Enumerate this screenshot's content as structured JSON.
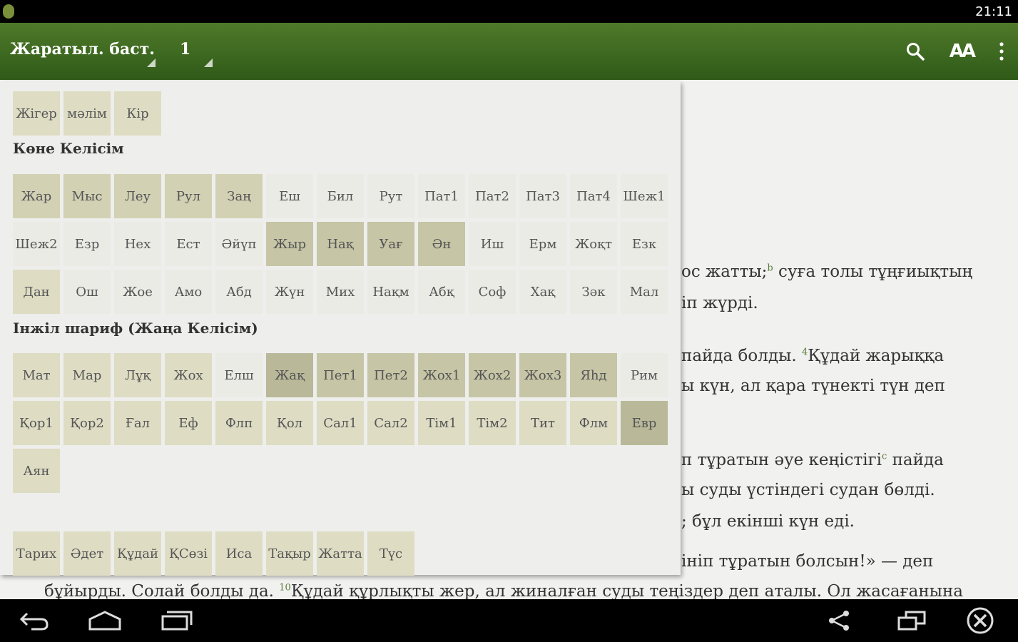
{
  "status_bar": {
    "time": "21:11"
  },
  "action_bar": {
    "book_title": "Жаратыл. баст.",
    "chapter": "1",
    "icons": [
      "search-icon",
      "text-size-icon",
      "overflow-menu-icon"
    ],
    "text_size_label": "AA"
  },
  "reader": {
    "lines": [
      {
        "text": "ос жатты;",
        "sup": "b",
        "rest": " суға толы тұңғиықтың"
      },
      {
        "text": "іп жүрді."
      },
      {
        "text": "пайда болды. ",
        "sup": "4",
        "rest": "Құдай жарыққа"
      },
      {
        "text": "ы күн, ал қара түнекті түн деп"
      },
      {
        "text": "п тұратын әуе кеңістігі",
        "sup": "c",
        "rest": " пайда"
      },
      {
        "text": "ы суды үстіндегі судан бөлді."
      },
      {
        "text": "; бұл екінші күн еді."
      },
      {
        "text": "інiп тұратын болсын!» — деп"
      },
      {
        "text": "бұйырды. Солай болды да. ",
        "sup": "10",
        "rest": "Құдай құрлықты жер, ал жиналған суды теңіздер деп аталы. Ол жасағанына"
      }
    ]
  },
  "popup": {
    "top_row": [
      "Жігер",
      "мәлім",
      "Кір"
    ],
    "old_testament_title": "Көне Келісім",
    "old_testament": [
      [
        "Жар",
        "Мыс",
        "Леу",
        "Рул",
        "Заң",
        "Еш",
        "Бил",
        "Рут",
        "Пат1",
        "Пат2",
        "Пат3",
        "Пат4",
        "Шеж1"
      ],
      [
        "Шеж2",
        "Езр",
        "Нех",
        "Ест",
        "Әйүп",
        "Жыр",
        "Нақ",
        "Уағ",
        "Ән",
        "Иш",
        "Ерм",
        "Жоқт",
        "Езк"
      ],
      [
        "Дан",
        "Ош",
        "Жое",
        "Амо",
        "Абд",
        "Жүн",
        "Мих",
        "Нақм",
        "Абқ",
        "Соф",
        "Хақ",
        "Зәк",
        "Мал"
      ]
    ],
    "new_testament_title": "Інжіл шариф (Жаңа Келісім)",
    "new_testament": [
      [
        "Мат",
        "Мар",
        "Лұқ",
        "Жох",
        "Елш",
        "Жақ",
        "Пет1",
        "Пет2",
        "Жох1",
        "Жох2",
        "Жох3",
        "Яһд",
        "Рим"
      ],
      [
        "Қор1",
        "Қор2",
        "Ғал",
        "Еф",
        "Флп",
        "Қол",
        "Сал1",
        "Сал2",
        "Тім1",
        "Тім2",
        "Тит",
        "Флм",
        "Евр"
      ],
      [
        "Аян"
      ]
    ],
    "bottom_row": [
      "Тарих",
      "Әдет",
      "Құдай",
      "ҚСөзі",
      "Иса",
      "Тақыр",
      "Жатта",
      "Түс"
    ]
  },
  "nav_bar": {
    "icons": [
      "back-icon",
      "home-icon",
      "recents-icon",
      "share-icon",
      "window-icon",
      "close-circle-icon"
    ]
  }
}
